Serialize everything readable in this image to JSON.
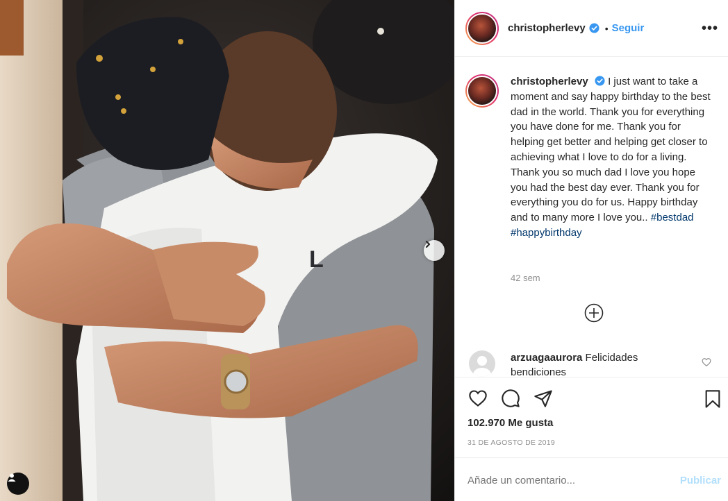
{
  "post": {
    "image_alt": "Two people hugging",
    "carousel_next_icon": "chevron-right-icon",
    "tag_icon": "user-tag-icon"
  },
  "header": {
    "username": "christopherlevy",
    "separator": "•",
    "follow_label": "Seguir",
    "more_icon": "more-horizontal-icon",
    "more_label": "•••"
  },
  "caption": {
    "username": "christopherlevy",
    "text": "I just want to take a moment and say happy birthday to the best dad in the world. Thank you for everything you have done for me. Thank you for helping get better and helping get closer to achieving what I love to do for a living. Thank you so much dad I love you hope you had the best day ever. Thank you for everything you do for us. Happy birthday and to many more I love you..",
    "hashtags": [
      "#bestdad",
      "#happybirthday"
    ],
    "time_ago": "42 sem"
  },
  "comments": [
    {
      "username": "arzuagaaurora",
      "text": "Felicidades bendiciones"
    }
  ],
  "actions": {
    "like_icon": "heart-icon",
    "comment_icon": "comment-icon",
    "share_icon": "paper-plane-icon",
    "save_icon": "bookmark-icon"
  },
  "likes": "102.970 Me gusta",
  "date": "31 DE AGOSTO DE 2019",
  "comment_box": {
    "placeholder": "Añade un comentario...",
    "publish_label": "Publicar"
  },
  "colors": {
    "link": "#3897f0",
    "hashtag": "#00376b",
    "muted": "#8e8e8e",
    "publish_disabled": "#b2dffc"
  }
}
